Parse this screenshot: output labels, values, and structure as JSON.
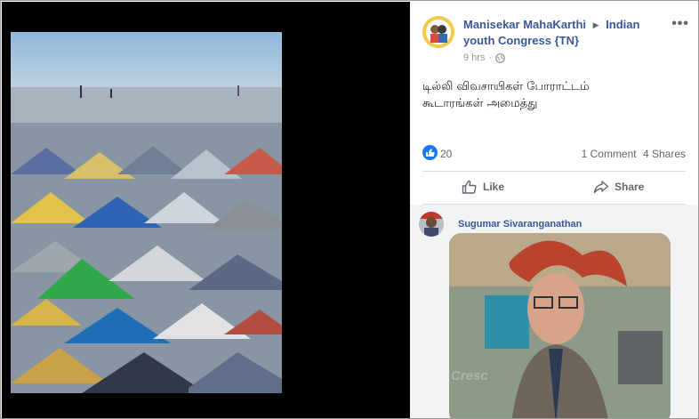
{
  "post": {
    "author": "Manisekar MahaKarthi",
    "group": "Indian youth Congress {TN}",
    "time": "9 hrs",
    "separator": "·",
    "more_label": "•••",
    "text_line1": "டில்லி விவசாயிகள் போராட்டம்",
    "text_line2": "கூடாரங்கள் அமைத்து"
  },
  "stats": {
    "likes": "20",
    "comments": "1 Comment",
    "shares": "4 Shares"
  },
  "actions": {
    "like": "Like",
    "share": "Share"
  },
  "comment": {
    "author": "Sugumar Sivaranganathan",
    "watermark": "Cresc"
  },
  "icons": {
    "avatar": "avatar-image",
    "group_arrow": "triangle-right-icon",
    "audience": "globe-icon",
    "like_badge": "thumbs-up-icon",
    "like": "thumbs-up-outline-icon",
    "share": "share-arrow-icon"
  },
  "colors": {
    "link": "#385898",
    "like_badge": "#1877f2",
    "viewer_bg": "#000000",
    "comment_bg": "#f2f3f5"
  }
}
